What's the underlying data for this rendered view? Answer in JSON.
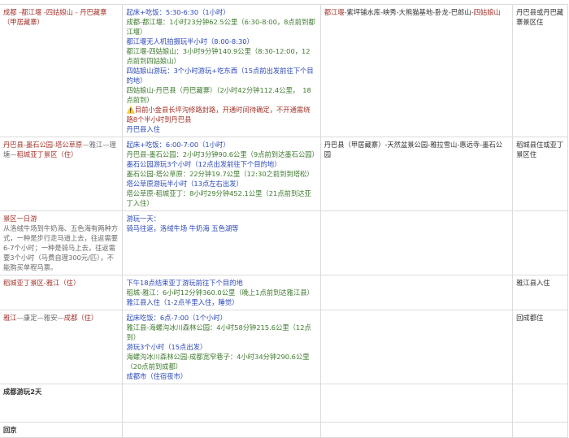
{
  "rows": [
    {
      "route": [
        {
          "t": "成都 -都江堰 -四姑娘山 - 丹巴藏寨（甲居藏寨）",
          "c": "red"
        }
      ],
      "schedule": [
        {
          "t": "起床+吃饭：5:30-6:30（1小时）",
          "c": "blue"
        },
        {
          "t": "成都-都江堰：1小时23分钟62.5公里（6:30-8:00，8点前到都江堰）",
          "c": "green"
        },
        {
          "t": "都江堰无人机拍摄玩半小时（8:00-8:30）",
          "c": "blue"
        },
        {
          "t": "都江堰-四姑娘山：3小时9分钟140.9公里（8:30-12:00，12点前到四姑娘山）",
          "c": "green"
        },
        {
          "t": "四姑娘山游玩：3个小时游玩+吃东西（15点前出发前往下个目的地）",
          "c": "blue"
        },
        {
          "t": "四姑娘山-丹巴县（丹巴藏寨）（2小时42分钟112.4公里，　18点前到）",
          "c": "green"
        },
        {
          "t": "⚠️目前小金县长坪沟修路封路，开通时间待确定，不开通需绕路8个半小时到丹巴县",
          "c": "warn"
        },
        {
          "t": "丹巴县入住",
          "c": "blue"
        }
      ],
      "sights": [
        {
          "t": "都江堰",
          "c": "red"
        },
        {
          "t": "-紫坪铺水库-映秀-大熊猫基地-卧龙-巴郎山-",
          "c": "black"
        },
        {
          "t": "四姑娘山",
          "c": "red"
        }
      ],
      "stay": "丹巴县或丹巴藏寨景区住"
    },
    {
      "route": [
        {
          "t": "丹巴县-墨石公园-塔公草原",
          "c": "red"
        },
        {
          "t": "—雅江—理塘—",
          "c": "gray"
        },
        {
          "t": "稻城亚丁景区（住）",
          "c": "red"
        }
      ],
      "schedule": [
        {
          "t": "起床+吃饭：6:00-7:00（1小时）",
          "c": "blue"
        },
        {
          "t": "丹巴县-墨石公园：2小时3分钟90.6公里（9点前到达墨石公园）",
          "c": "green"
        },
        {
          "t": "墨石公园游玩3个小时（12点出发前往下个目的地）",
          "c": "blue"
        },
        {
          "t": "墨石公园-塔公草原：22分钟19.7公里（12:30之前到到塔松）",
          "c": "green"
        },
        {
          "t": "塔公草原游玩半小时（13点左右出发）",
          "c": "blue"
        },
        {
          "t": "塔公草原-稻城亚丁：8小时29分钟452.1公里（21点前到达亚丁入住）",
          "c": "green"
        }
      ],
      "sights": [
        {
          "t": "丹巴县（甲居藏寨）-天然盆景公园-雅拉雪山-惠远寺-墨石公园",
          "c": "black"
        }
      ],
      "stay": "稻城县住或亚丁景区住"
    },
    {
      "route": [
        {
          "t": "景区一日游",
          "c": "red",
          "block": true
        },
        {
          "t": "从洛绒牛场到牛奶海、五色海有两种方式，一种是步行走马道上去，往返需要6-7个小时；一种是骑马上去，往返需要3个小时（马费自理300元/匹），不能购买单程马票。",
          "c": "gray"
        }
      ],
      "schedule": [
        {
          "t": "游玩一天：",
          "c": "blue"
        },
        {
          "t": "骑马往返，洛绒牛场 牛奶海 五色湖等",
          "c": "blue"
        }
      ],
      "sights": [],
      "stay": ""
    },
    {
      "route": [
        {
          "t": "稻城亚丁景区-雅江（住）",
          "c": "red"
        }
      ],
      "schedule": [
        {
          "t": "下午18点结束亚丁游玩前往下个目的地",
          "c": "blue"
        },
        {
          "t": "稻城-雅江：6小时12分钟360.0公里（晚上1点前到达雅江县）",
          "c": "green"
        },
        {
          "t": "雅江县入住（1-2点半里入住，睡觉）",
          "c": "blue"
        }
      ],
      "sights": [],
      "stay": "雅江县入住"
    },
    {
      "route": [
        {
          "t": "雅江",
          "c": "red"
        },
        {
          "t": "—康定—雅安—",
          "c": "gray"
        },
        {
          "t": "成都（住）",
          "c": "red"
        }
      ],
      "schedule": [
        {
          "t": "起床吃饭：6点-7:00（1个小时）",
          "c": "blue"
        },
        {
          "t": "雅江县-海螺沟冰川森林公园：4小时58分钟215.6公里（12点到）",
          "c": "green"
        },
        {
          "t": "游玩3个小时（15点出发）",
          "c": "blue"
        },
        {
          "t": "海螺沟冰川森林公园-成都宽窄巷子：4小时34分钟290.6公里（20点前到成都）",
          "c": "green"
        },
        {
          "t": "成都市（住宿夜市）",
          "c": "blue"
        }
      ],
      "sights": [],
      "stay": "回成都住"
    },
    {
      "route": [
        {
          "t": "成都游玩2天",
          "c": "bold"
        }
      ],
      "schedule": [],
      "sights": [],
      "stay": ""
    },
    {
      "route": [
        {
          "t": "回京",
          "c": "bold"
        }
      ],
      "schedule": [],
      "sights": [],
      "stay": ""
    }
  ]
}
